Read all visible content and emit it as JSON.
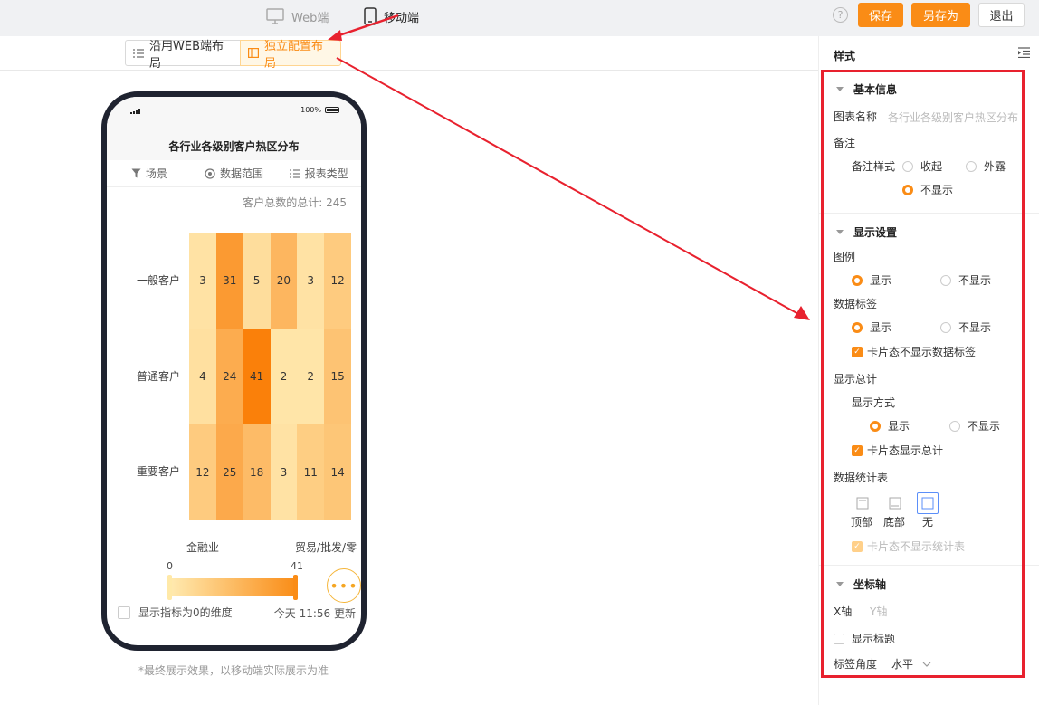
{
  "topbar": {
    "web_label": "Web端",
    "mobile_label": "移动端",
    "help": "?",
    "save_label": "保存",
    "save_as_label": "另存为",
    "exit_label": "退出"
  },
  "layout_toggle": {
    "web_layout": "沿用WEB端布局",
    "independent_layout": "独立配置布局"
  },
  "preview": {
    "status_battery": "100%",
    "title": "各行业各级别客户热区分布",
    "tabs": [
      "场景",
      "数据范围",
      "报表类型"
    ],
    "total": "客户总数的总计:  245",
    "row_labels": [
      "一般客户",
      "普通客户",
      "重要客户"
    ],
    "col_labels": [
      "金融业",
      "贸易/批发/零"
    ],
    "legend_min": "0",
    "legend_max": "41",
    "zero_check_label": "显示指标为0的维度",
    "update_text": "今天 11:56 更新",
    "footnote": "*最终展示效果，以移动端实际展示为准"
  },
  "chart_data": {
    "type": "heatmap",
    "title": "各行业各级别客户热区分布",
    "rows": [
      "一般客户",
      "普通客户",
      "重要客户"
    ],
    "columns_visible": [
      "金融业",
      "",
      "",
      "",
      "贸易/批发/零",
      ""
    ],
    "values": [
      [
        3,
        31,
        5,
        20,
        3,
        12
      ],
      [
        4,
        24,
        41,
        2,
        2,
        15
      ],
      [
        12,
        25,
        18,
        3,
        11,
        14
      ]
    ],
    "min": 0,
    "max": 41,
    "total": 245,
    "colors": {
      "low": "#ffeab0",
      "high": "#fa8c16"
    },
    "legend": "bottom"
  },
  "panel": {
    "title": "样式",
    "basic": {
      "title": "基本信息",
      "chart_name_label": "图表名称",
      "chart_name_placeholder": "各行业各级别客户热区分布",
      "remark_label": "备注",
      "remark_style_label": "备注样式",
      "remark_options": [
        "收起",
        "外露",
        "不显示"
      ],
      "remark_selected": "不显示"
    },
    "display": {
      "title": "显示设置",
      "legend_label": "图例",
      "show": "显示",
      "hide": "不显示",
      "data_label_label": "数据标签",
      "card_no_data_label": "卡片态不显示数据标签",
      "total_label": "显示总计",
      "total_mode_label": "显示方式",
      "card_show_total": "卡片态显示总计",
      "stat_table_label": "数据统计表",
      "stat_positions": [
        "顶部",
        "底部",
        "无"
      ],
      "stat_selected": "无",
      "card_no_stat": "卡片态不显示统计表"
    },
    "axis": {
      "title": "坐标轴",
      "x_tab": "X轴",
      "y_tab": "Y轴",
      "show_title": "显示标题",
      "angle_label": "标签角度",
      "angle_value": "水平"
    }
  },
  "colors": {
    "accent": "#fa8c16",
    "highlight_frame": "#e8212e"
  }
}
